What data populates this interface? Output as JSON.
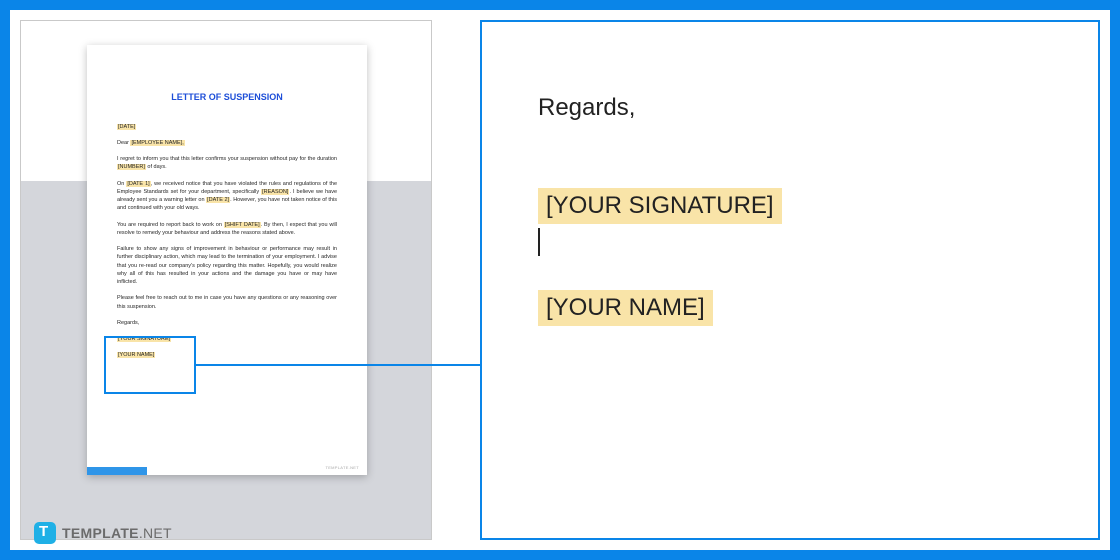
{
  "doc": {
    "title": "LETTER OF SUSPENSION",
    "date_ph": "[DATE]",
    "dear": "Dear ",
    "employee_ph": "[EMPLOYEE NAME],",
    "p1a": "I regret to inform you that this letter confirms your suspension without pay for the duration ",
    "p1_num": "[NUMBER]",
    "p1b": " of days.",
    "p2a": "On ",
    "p2_date1": "[DATE 1]",
    "p2b": ", we received notice that you have violated the rules and regulations of the Employee Standards set for your department, specifically ",
    "p2_reason": "[REASON]",
    "p2c": ". I believe we have already sent you a warning letter on ",
    "p2_date2": "[DATE 2]",
    "p2d": ". However, you have not taken notice of this and continued with your old ways.",
    "p3a": "You are required to report back to work on ",
    "p3_shift": "[SHIFT DATE]",
    "p3b": ". By then, I expect that you will resolve to remedy your behaviour and address the reasons stated above.",
    "p4": "Failure to show any signs of improvement in behaviour or performance may result in further disciplinary action, which may lead to the termination of your employment. I advise that you re-read our company's policy regarding this matter. Hopefully, you would realize why all of this has resulted in your actions and the damage you have or may have inflicted.",
    "p5": "Please feel free to reach out to me in case you have any questions or any reasoning over this suspension.",
    "regards": "Regards,",
    "sig_ph": "[YOUR SIGNATURE]",
    "name_ph": "[YOUR NAME]",
    "watermark": "TEMPLATE.NET"
  },
  "zoom": {
    "regards": "Regards,",
    "sig": "[YOUR SIGNATURE]",
    "name": "[YOUR NAME]"
  },
  "brand": {
    "main": "TEMPLATE",
    "suffix": ".NET"
  }
}
